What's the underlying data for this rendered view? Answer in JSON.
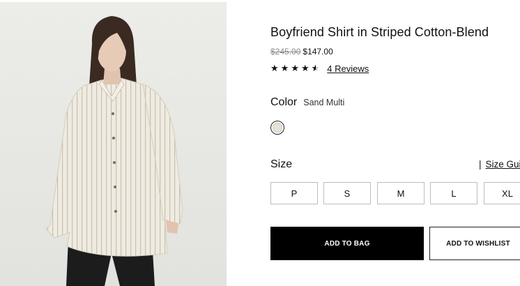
{
  "product": {
    "title": "Boyfriend Shirt in Striped Cotton-Blend",
    "original_price": "$245.00",
    "sale_price": "$147.00",
    "rating_stars": 4.5,
    "reviews_link": "4 Reviews"
  },
  "color": {
    "label": "Color",
    "selected_value": "Sand Multi",
    "swatch_color": "#e7e3d9"
  },
  "size": {
    "label": "Size",
    "guide_separator": "|",
    "guide_link": "Size Gui",
    "options": [
      "P",
      "S",
      "M",
      "L",
      "XL"
    ]
  },
  "actions": {
    "add_to_bag": "ADD TO BAG",
    "add_to_wishlist": "ADD TO WISHLIST"
  },
  "icons": {
    "star": "star-icon",
    "half_star": "half-star-icon"
  },
  "colors": {
    "primary_button": "#000000",
    "size_border": "#bdbdbd",
    "strikethrough_price": "#8a8a8a"
  }
}
